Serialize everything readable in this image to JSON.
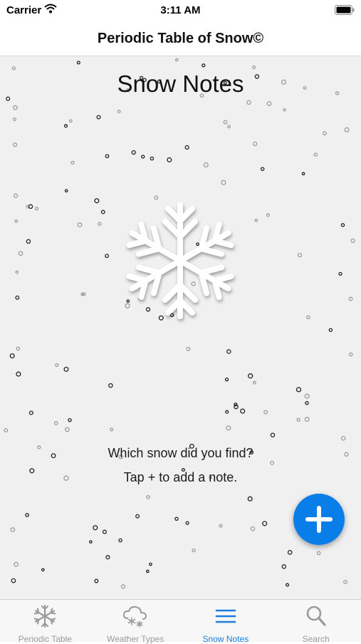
{
  "status_bar": {
    "carrier": "Carrier",
    "time": "3:11 AM"
  },
  "nav": {
    "title": "Periodic Table of Snow©"
  },
  "main": {
    "heading": "Snow Notes",
    "prompt_line1": "Which snow did you find?",
    "prompt_line2": "Tap + to add a note."
  },
  "fab": {
    "icon": "plus-icon"
  },
  "tabs": [
    {
      "label": "Periodic Table",
      "icon": "snowflake-icon",
      "active": false
    },
    {
      "label": "Weather Types",
      "icon": "snow-cloud-icon",
      "active": false
    },
    {
      "label": "Snow Notes",
      "icon": "list-icon",
      "active": true
    },
    {
      "label": "Search",
      "icon": "search-icon",
      "active": false
    }
  ],
  "colors": {
    "accent": "#1a7fe0",
    "fab": "#0a7ee8",
    "background": "#f0f0f0"
  }
}
